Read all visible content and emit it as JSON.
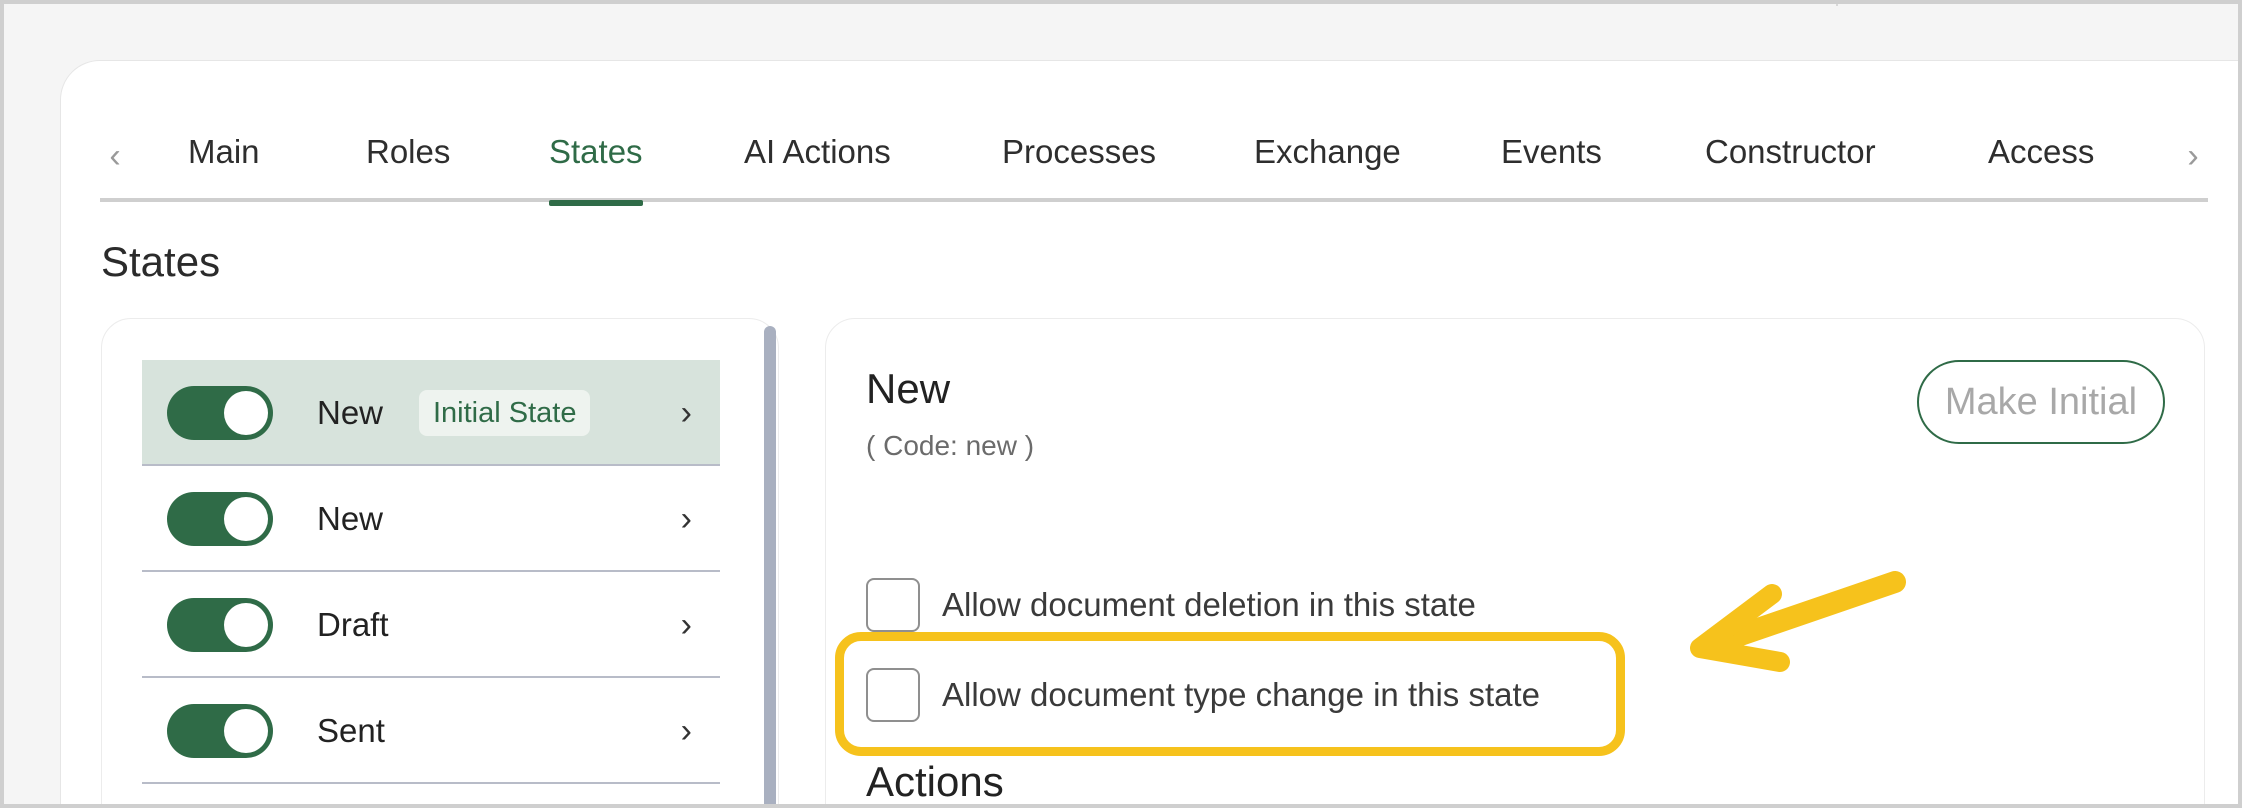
{
  "tabs": [
    {
      "label": "Main"
    },
    {
      "label": "Roles"
    },
    {
      "label": "States"
    },
    {
      "label": "AI Actions"
    },
    {
      "label": "Processes"
    },
    {
      "label": "Exchange"
    },
    {
      "label": "Events"
    },
    {
      "label": "Constructor"
    },
    {
      "label": "Access"
    }
  ],
  "active_tab": "States",
  "section_title": "States",
  "states": [
    {
      "name": "New",
      "badge": "Initial State",
      "enabled": true,
      "selected": true
    },
    {
      "name": "New",
      "enabled": true,
      "selected": false
    },
    {
      "name": "Draft",
      "enabled": true,
      "selected": false
    },
    {
      "name": "Sent",
      "enabled": true,
      "selected": false
    }
  ],
  "detail": {
    "title": "New",
    "code": "( Code: new )",
    "make_initial_label": "Make Initial",
    "checkboxes": [
      {
        "label": "Allow document deletion in this state",
        "checked": false
      },
      {
        "label": "Allow document type change in this state",
        "checked": false
      }
    ],
    "actions_title": "Actions"
  },
  "icons": {
    "tab_prev": "chevron-left-icon",
    "tab_next": "chevron-right-icon",
    "row_chevron": "chevron-right-icon"
  },
  "colors": {
    "accent": "#2f6b47",
    "selected_row": "#d7e3dc",
    "highlight": "#f6c21c"
  }
}
